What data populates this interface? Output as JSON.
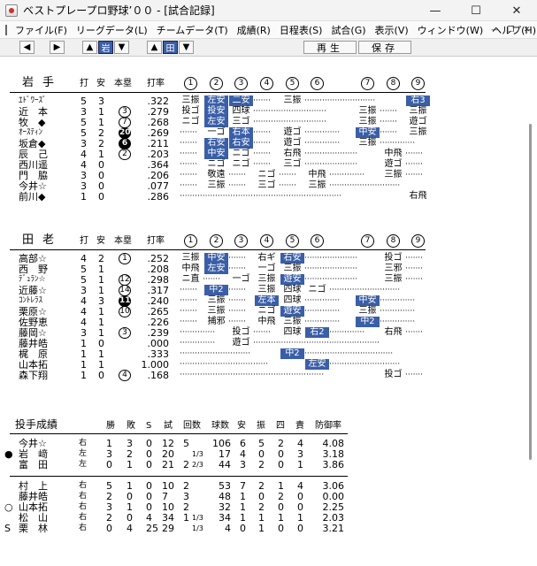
{
  "window": {
    "title": "ベストプレープロ野球’００ - [試合記録]"
  },
  "menu": [
    "ファイル(F)",
    "リーグデータ(L)",
    "チームデータ(T)",
    "成績(R)",
    "日程表(S)",
    "試合(G)",
    "表示(V)",
    "ウィンドウ(W)",
    "ヘルプ(H)"
  ],
  "toolbar": {
    "btn_prev": "◆",
    "btn_next": "➡",
    "team_a": "岩",
    "team_b": "田",
    "replay": "再生",
    "save": "保存"
  },
  "header": {
    "hit": "打",
    "safe": "安",
    "hr": "本塁",
    "avg": "打率",
    "innings": [
      "1",
      "2",
      "3",
      "4",
      "5",
      "6",
      "7",
      "8",
      "9"
    ]
  },
  "team1": {
    "name": "岩手",
    "players": [
      {
        "name": "ｴﾄﾞﾜｰｽﾞ",
        "ab": "5",
        "h": "3",
        "hr": "",
        "hrf": false,
        "avg": ".322",
        "res": [
          "三振",
          "左安",
          "二安",
          "",
          "三振",
          "",
          "",
          "",
          "右3"
        ],
        "hits": [
          false,
          true,
          true,
          false,
          false,
          false,
          false,
          false,
          true
        ]
      },
      {
        "name": "近　本",
        "ab": "3",
        "h": "1",
        "hr": "3",
        "hrf": false,
        "avg": ".279",
        "res": [
          "投ゴ",
          "投安",
          "四球",
          "",
          "",
          "",
          "三振",
          "",
          "三振"
        ],
        "hits": [
          false,
          true,
          false,
          false,
          false,
          false,
          false,
          false,
          false
        ]
      },
      {
        "name": "牧　◆",
        "ab": "5",
        "h": "1",
        "hr": "7",
        "hrf": false,
        "avg": ".268",
        "res": [
          "ニゴ",
          "左安",
          "三ゴ",
          "",
          "",
          "",
          "三振",
          "",
          "遊ゴ"
        ],
        "hits": [
          false,
          true,
          false,
          false,
          false,
          false,
          false,
          false,
          false
        ]
      },
      {
        "name": "ｵｰｽﾃｨﾝ",
        "ab": "5",
        "h": "2",
        "hr": "20",
        "hrf": true,
        "avg": ".269",
        "res": [
          "",
          "一ゴ",
          "右本",
          "",
          "遊ゴ",
          "",
          "中安",
          "",
          "三振"
        ],
        "hits": [
          false,
          false,
          true,
          false,
          false,
          false,
          true,
          false,
          false
        ]
      },
      {
        "name": "坂倉◆",
        "ab": "3",
        "h": "2",
        "hr": "6",
        "hrf": true,
        "avg": ".211",
        "res": [
          "",
          "右安",
          "右安",
          "",
          "遊ゴ",
          "",
          "三振",
          "",
          ""
        ],
        "hits": [
          false,
          true,
          true,
          false,
          false,
          false,
          false,
          false,
          false
        ]
      },
      {
        "name": "辰　己",
        "ab": "4",
        "h": "1",
        "hr": "2",
        "hrf": false,
        "avg": ".203",
        "res": [
          "",
          "中安",
          "ニゴ",
          "",
          "右飛",
          "",
          "",
          "中飛",
          ""
        ],
        "hits": [
          false,
          true,
          false,
          false,
          false,
          false,
          false,
          false,
          false
        ]
      },
      {
        "name": "西川遥",
        "ab": "4",
        "h": "0",
        "hr": "",
        "hrf": false,
        "avg": ".364",
        "res": [
          "",
          "ニゴ",
          "ニゴ",
          "",
          "三ゴ",
          "",
          "",
          "遊ゴ",
          ""
        ],
        "hits": [
          false,
          false,
          false,
          false,
          false,
          false,
          false,
          false,
          false
        ]
      },
      {
        "name": "門　脇",
        "ab": "3",
        "h": "0",
        "hr": "",
        "hrf": false,
        "avg": ".206",
        "res": [
          "",
          "敬遠",
          "",
          "ニゴ",
          "",
          "中飛",
          "",
          "三振",
          ""
        ],
        "hits": [
          false,
          false,
          false,
          false,
          false,
          false,
          false,
          false,
          false
        ]
      },
      {
        "name": "今井☆",
        "ab": "3",
        "h": "0",
        "hr": "",
        "hrf": false,
        "avg": ".077",
        "res": [
          "",
          "三振",
          "",
          "三ゴ",
          "",
          "三振",
          "",
          "",
          ""
        ],
        "hits": [
          false,
          false,
          false,
          false,
          false,
          false,
          false,
          false,
          false
        ]
      },
      {
        "name": "前川◆",
        "ab": "1",
        "h": "0",
        "hr": "",
        "hrf": false,
        "avg": ".286",
        "res": [
          "",
          "",
          "",
          "",
          "",
          "",
          "",
          "",
          "右飛"
        ],
        "hits": [
          false,
          false,
          false,
          false,
          false,
          false,
          false,
          false,
          false
        ]
      }
    ]
  },
  "team2": {
    "name": "田老",
    "players": [
      {
        "name": "高部☆",
        "ab": "4",
        "h": "2",
        "hr": "1",
        "hrf": false,
        "avg": ".252",
        "res": [
          "三振",
          "中安",
          "",
          "右ギ",
          "右安",
          "",
          "",
          "投ゴ",
          ""
        ],
        "hits": [
          false,
          true,
          false,
          false,
          true,
          false,
          false,
          false,
          false
        ]
      },
      {
        "name": "西　野",
        "ab": "5",
        "h": "1",
        "hr": "",
        "hrf": false,
        "avg": ".208",
        "res": [
          "中飛",
          "左安",
          "",
          "一ゴ",
          "三振",
          "",
          "",
          "三邪",
          ""
        ],
        "hits": [
          false,
          true,
          false,
          false,
          false,
          false,
          false,
          false,
          false
        ]
      },
      {
        "name": "ﾃﾞｭﾗﾝ☆",
        "ab": "5",
        "h": "1",
        "hr": "12",
        "hrf": false,
        "avg": ".298",
        "res": [
          "ニ直",
          "",
          "一ゴ",
          "三振",
          "遊安",
          "",
          "",
          "三振",
          ""
        ],
        "hits": [
          false,
          false,
          false,
          false,
          true,
          false,
          false,
          false,
          false
        ]
      },
      {
        "name": "近藤☆",
        "ab": "3",
        "h": "1",
        "hr": "14",
        "hrf": false,
        "avg": ".317",
        "res": [
          "",
          "中2",
          "",
          "三振",
          "四球",
          "ニゴ",
          "",
          "",
          ""
        ],
        "hits": [
          false,
          true,
          false,
          false,
          false,
          false,
          false,
          false,
          false
        ]
      },
      {
        "name": "ｺﾝﾄﾚﾗｽ",
        "ab": "4",
        "h": "3",
        "hr": "11",
        "hrf": true,
        "avg": ".240",
        "res": [
          "",
          "三振",
          "",
          "左本",
          "四球",
          "",
          "中安",
          "",
          ""
        ],
        "hits": [
          false,
          false,
          false,
          true,
          false,
          false,
          true,
          false,
          false
        ]
      },
      {
        "name": "栗原☆",
        "ab": "4",
        "h": "1",
        "hr": "10",
        "hrf": false,
        "avg": ".265",
        "res": [
          "",
          "三振",
          "",
          "ニゴ",
          "遊安",
          "",
          "三振",
          "",
          ""
        ],
        "hits": [
          false,
          false,
          false,
          false,
          true,
          false,
          false,
          false,
          false
        ]
      },
      {
        "name": "佐野恵",
        "ab": "4",
        "h": "1",
        "hr": "",
        "hrf": false,
        "avg": ".226",
        "res": [
          "",
          "捕邪",
          "",
          "中飛",
          "三振",
          "",
          "中2",
          "",
          ""
        ],
        "hits": [
          false,
          false,
          false,
          false,
          false,
          false,
          true,
          false,
          false
        ]
      },
      {
        "name": "藤岡☆",
        "ab": "3",
        "h": "1",
        "hr": "3",
        "hrf": false,
        "avg": ".239",
        "res": [
          "",
          "",
          "投ゴ",
          "",
          "四球",
          "右2",
          "",
          "右飛",
          ""
        ],
        "hits": [
          false,
          false,
          false,
          false,
          false,
          true,
          false,
          false,
          false
        ]
      },
      {
        "name": "藤井皓",
        "ab": "1",
        "h": "0",
        "hr": "",
        "hrf": false,
        "avg": ".000",
        "res": [
          "",
          "",
          "遊ゴ",
          "",
          "",
          "",
          "",
          "",
          ""
        ],
        "hits": [
          false,
          false,
          false,
          false,
          false,
          false,
          false,
          false,
          false
        ]
      },
      {
        "name": "梶　原",
        "ab": "1",
        "h": "1",
        "hr": "",
        "hrf": false,
        "avg": ".333",
        "res": [
          "",
          "",
          "",
          "",
          "中2",
          "",
          "",
          "",
          ""
        ],
        "hits": [
          false,
          false,
          false,
          false,
          true,
          false,
          false,
          false,
          false
        ]
      },
      {
        "name": "山本拓",
        "ab": "1",
        "h": "1",
        "hr": "",
        "hrf": false,
        "avg": "1.000",
        "res": [
          "",
          "",
          "",
          "",
          "",
          "左安",
          "",
          "",
          ""
        ],
        "hits": [
          false,
          false,
          false,
          false,
          false,
          true,
          false,
          false,
          false
        ]
      },
      {
        "name": "森下翔",
        "ab": "1",
        "h": "0",
        "hr": "4",
        "hrf": false,
        "avg": ".168",
        "res": [
          "",
          "",
          "",
          "",
          "",
          "",
          "",
          "投ゴ",
          ""
        ],
        "hits": [
          false,
          false,
          false,
          false,
          false,
          false,
          false,
          false,
          false
        ]
      }
    ]
  },
  "pitching": {
    "title": "投手成績",
    "headers": [
      "勝",
      "敗",
      "S",
      "試",
      "回数",
      "球数",
      "安",
      "振",
      "四",
      "責",
      "防御率"
    ],
    "group1": [
      {
        "mark": "",
        "name": "今井☆",
        "hand": "右",
        "w": "1",
        "l": "3",
        "s": "0",
        "g": "12",
        "ip": "5",
        "ipf": "",
        "pc": "106",
        "h": "6",
        "k": "5",
        "bb": "2",
        "er": "4",
        "era": "4.08"
      },
      {
        "mark": "●",
        "name": "岩　﨑",
        "hand": "左",
        "w": "3",
        "l": "2",
        "s": "0",
        "g": "20",
        "ip": "",
        "ipf": "1/3",
        "pc": "17",
        "h": "4",
        "k": "0",
        "bb": "0",
        "er": "3",
        "era": "3.18"
      },
      {
        "mark": "",
        "name": "富　田",
        "hand": "左",
        "w": "0",
        "l": "1",
        "s": "0",
        "g": "21",
        "ip": "2",
        "ipf": "2/3",
        "pc": "44",
        "h": "3",
        "k": "2",
        "bb": "0",
        "er": "1",
        "era": "3.86"
      }
    ],
    "group2": [
      {
        "mark": "",
        "name": "村　上",
        "hand": "右",
        "w": "5",
        "l": "1",
        "s": "0",
        "g": "10",
        "ip": "2",
        "ipf": "",
        "pc": "53",
        "h": "7",
        "k": "2",
        "bb": "1",
        "er": "4",
        "era": "3.06"
      },
      {
        "mark": "",
        "name": "藤井皓",
        "hand": "右",
        "w": "2",
        "l": "0",
        "s": "0",
        "g": "7",
        "ip": "3",
        "ipf": "",
        "pc": "48",
        "h": "1",
        "k": "0",
        "bb": "2",
        "er": "0",
        "era": "0.00"
      },
      {
        "mark": "○",
        "name": "山本拓",
        "hand": "右",
        "w": "3",
        "l": "1",
        "s": "0",
        "g": "10",
        "ip": "2",
        "ipf": "",
        "pc": "32",
        "h": "1",
        "k": "2",
        "bb": "0",
        "er": "0",
        "era": "2.25"
      },
      {
        "mark": "",
        "name": "松　山",
        "hand": "右",
        "w": "2",
        "l": "0",
        "s": "4",
        "g": "34",
        "ip": "1",
        "ipf": "1/3",
        "pc": "34",
        "h": "1",
        "k": "1",
        "bb": "1",
        "er": "1",
        "era": "2.03"
      },
      {
        "mark": "S",
        "name": "栗　林",
        "hand": "右",
        "w": "0",
        "l": "4",
        "s": "25",
        "g": "29",
        "ip": "",
        "ipf": "1/3",
        "pc": "4",
        "h": "0",
        "k": "1",
        "bb": "0",
        "er": "0",
        "era": "3.21"
      }
    ]
  }
}
